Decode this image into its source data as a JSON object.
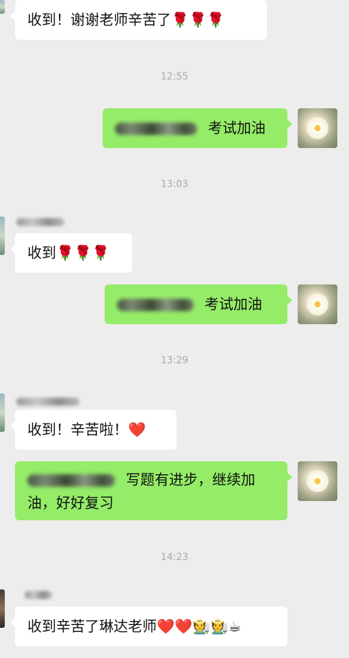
{
  "messages": [
    {
      "text": "收到！谢谢老师辛苦了🌹🌹🌹"
    },
    {
      "time": "12:55"
    },
    {
      "text": "考试加油"
    },
    {
      "time": "13:03"
    },
    {
      "text": "收到🌹🌹🌹"
    },
    {
      "text": "考试加油"
    },
    {
      "time": "13:29"
    },
    {
      "text": "收到！辛苦啦！❤️"
    },
    {
      "text": "写题有进步，继续加油，好好复习"
    },
    {
      "time": "14:23"
    },
    {
      "text": "收到辛苦了琳达老师❤️❤️🧑‍🌾🧑‍🌾☕"
    }
  ],
  "icons": {
    "avatar": "flower-photo-avatar",
    "contact": "contact-avatar"
  },
  "colors": {
    "background": "#ededed",
    "outgoing_bubble": "#95ec69",
    "incoming_bubble": "#ffffff",
    "timestamp": "#a8a8a8"
  }
}
